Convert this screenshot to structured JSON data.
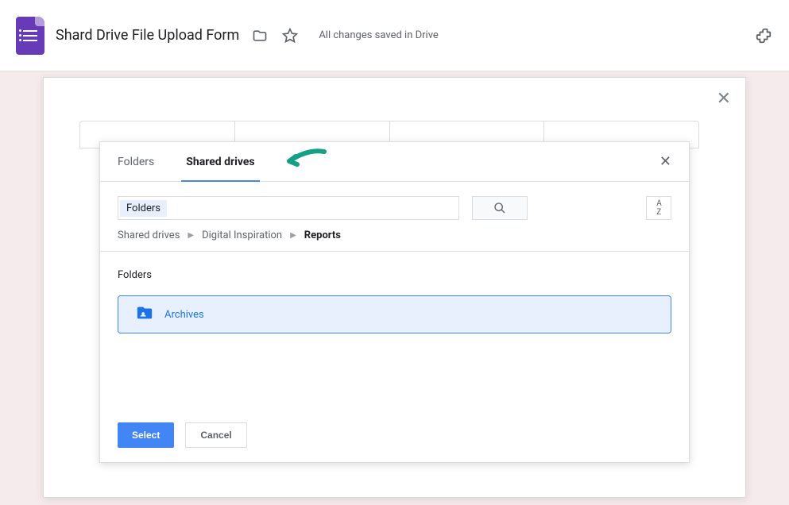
{
  "header": {
    "title": "Shard Drive File Upload Form",
    "save_status": "All changes saved in Drive"
  },
  "picker": {
    "tabs": {
      "folders": "Folders",
      "shared_drives": "Shared drives"
    },
    "search_chip": "Folders",
    "breadcrumbs": {
      "root": "Shared drives",
      "mid": "Digital Inspiration",
      "current": "Reports"
    },
    "section_label": "Folders",
    "folder_item": "Archives",
    "buttons": {
      "select": "Select",
      "cancel": "Cancel"
    }
  }
}
